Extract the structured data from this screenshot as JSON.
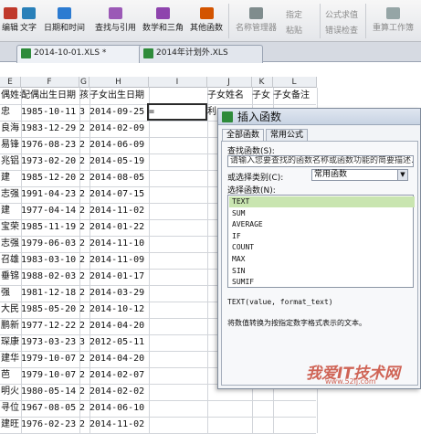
{
  "ribbon": {
    "buttons": [
      {
        "label": "编辑",
        "icon": "edit-icon",
        "color": "#c0392b"
      },
      {
        "label": "文字",
        "icon": "text-icon",
        "color": "#2980b9"
      },
      {
        "label": "日期和时间",
        "icon": "calendar-icon",
        "color": "#2c7bd1"
      },
      {
        "label": "查找与引用",
        "icon": "lookup-icon",
        "color": "#9b59b6"
      },
      {
        "label": "数学和三角",
        "icon": "math-icon",
        "color": "#8e44ad"
      },
      {
        "label": "其他函数",
        "icon": "more-functions-icon",
        "color": "#d35400"
      },
      {
        "label": "名称管理器",
        "icon": "name-manager-icon",
        "color": "#7f8c8d"
      },
      {
        "label": "粘贴",
        "icon": "paste-icon",
        "color": "#e6a23c"
      },
      {
        "label": "错误检查",
        "icon": "error-check-icon",
        "color": "#95a5a6"
      },
      {
        "label": "重算工作簿",
        "icon": "recalc-icon",
        "color": "#95a5a6"
      }
    ],
    "small": {
      "define": "指定",
      "formula_values": "公式求值"
    }
  },
  "tabs": [
    {
      "label": "2014-10-01.XLS *"
    },
    {
      "label": "2014年计划外.XLS"
    }
  ],
  "columns": [
    "E",
    "F",
    "G",
    "H",
    "I",
    "J",
    "K",
    "L"
  ],
  "header_row": [
    "偶姓名",
    "配偶出生日期",
    "孩",
    "子女出生日期",
    "",
    "子女姓名",
    "子女",
    "子女备注"
  ],
  "rows": [
    [
      "忠",
      "1985-10-11",
      "3",
      "2014-09-25",
      "=",
      "利"
    ],
    [
      "良海",
      "1983-12-29",
      "2",
      "2014-02-09",
      "",
      ""
    ],
    [
      "易锋",
      "1976-08-23",
      "2",
      "2014-06-09",
      "",
      ""
    ],
    [
      "兆铝",
      "1973-02-20",
      "2",
      "2014-05-19",
      "",
      ""
    ],
    [
      "建",
      "1985-12-20",
      "2",
      "2014-08-05",
      "",
      ""
    ],
    [
      "志强",
      "1991-04-23",
      "2",
      "2014-07-15",
      "",
      ""
    ],
    [
      "建",
      "1977-04-14",
      "2",
      "2014-11-02",
      "",
      ""
    ],
    [
      "宝荣",
      "1985-11-19",
      "2",
      "2014-01-22",
      "",
      ""
    ],
    [
      "志强",
      "1979-06-03",
      "2",
      "2014-11-10",
      "",
      ""
    ],
    [
      "召雄",
      "1983-03-10",
      "2",
      "2014-11-09",
      "",
      ""
    ],
    [
      "垂锦",
      "1988-02-03",
      "2",
      "2014-01-17",
      "",
      ""
    ],
    [
      "强",
      "1981-12-18",
      "2",
      "2014-03-29",
      "",
      ""
    ],
    [
      "大民",
      "1985-05-20",
      "2",
      "2014-10-12",
      "",
      ""
    ],
    [
      "鹏新",
      "1977-12-22",
      "2",
      "2014-04-20",
      "",
      ""
    ],
    [
      "琛康",
      "1973-03-23",
      "3",
      "2012-05-11",
      "",
      ""
    ],
    [
      "建华",
      "1979-10-07",
      "2",
      "2014-04-20",
      "",
      ""
    ],
    [
      "芭",
      "1979-10-07",
      "2",
      "2014-02-07",
      "",
      ""
    ],
    [
      "明火",
      "1980-05-14",
      "2",
      "2014-02-02",
      "",
      ""
    ],
    [
      "寻位",
      "1967-08-05",
      "2",
      "2014-06-10",
      "",
      ""
    ],
    [
      "建旺",
      "1976-02-23",
      "2",
      "2014-11-02",
      "",
      ""
    ]
  ],
  "dialog": {
    "title": "插入函数",
    "tabs": [
      "全部函数",
      "常用公式"
    ],
    "search_label": "查找函数(S):",
    "search_placeholder": "请输入您要查找的函数名称或函数功能的简要描述...",
    "category_label": "或选择类别(C):",
    "category_value": "常用函数",
    "select_label": "选择函数(N):",
    "functions": [
      "TEXT",
      "SUM",
      "AVERAGE",
      "IF",
      "COUNT",
      "MAX",
      "SIN",
      "SUMIF"
    ],
    "selected_index": 0,
    "signature": "TEXT(value, format_text)",
    "description": "将数值转换为按指定数字格式表示的文本。"
  },
  "watermark": {
    "text": "我爱IT技术网",
    "url": "www.52ij.com"
  }
}
